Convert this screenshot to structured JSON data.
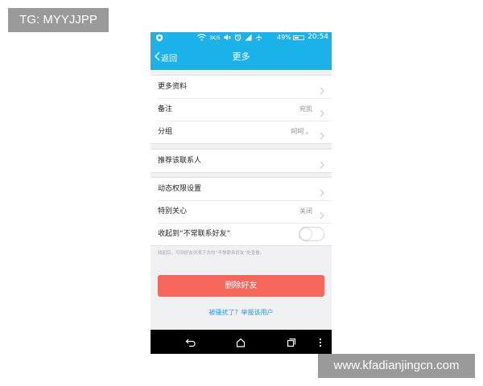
{
  "watermarks": {
    "top": "TG: MYYJJPP",
    "bottom": "www.kfadianjingcn.com"
  },
  "status_bar": {
    "net_speed": "3K/S",
    "battery_percent": "49%",
    "battery_level": 0.49,
    "time": "20:54",
    "icons": [
      "shield-icon",
      "wifi-icon",
      "speed-indicator",
      "mute-icon",
      "alarm-icon",
      "signal-icon",
      "airplane-icon",
      "battery-icon"
    ]
  },
  "nav": {
    "back_label": "返回",
    "title": "更多"
  },
  "groups": {
    "info": [
      {
        "label": "更多资料",
        "value": ""
      },
      {
        "label": "备注",
        "value": "宛凯"
      },
      {
        "label": "分组",
        "value": "呵呵 。"
      }
    ],
    "recommend": [
      {
        "label": "推荐该联系人",
        "value": ""
      }
    ],
    "privacy": [
      {
        "label": "动态权限设置",
        "value": ""
      },
      {
        "label": "特别关心",
        "value": "关闭"
      },
      {
        "label": "收起到“不常联系好友”",
        "value": "",
        "toggle": false
      }
    ]
  },
  "hint": "收起后，可到好友列表下方的“不常联系好友”处查看。",
  "delete_button": "删除好友",
  "report_link": "被骚扰了？举报该用户",
  "colors": {
    "accent": "#1bb1e9",
    "danger": "#f7665a",
    "link": "#1a9ee0",
    "background": "#f1f1f4"
  }
}
